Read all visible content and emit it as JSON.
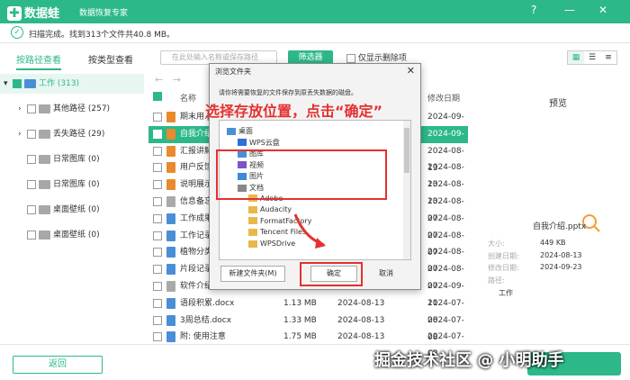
{
  "app": {
    "name": "数据蛙",
    "subtitle": "数据恢复专家",
    "help": "?",
    "minimize": "—",
    "close": "✕"
  },
  "status": {
    "text": "扫描完成。找到313个文件共40.8 MB。"
  },
  "tabs": {
    "by_path": "按路径查看",
    "by_type": "按类型查看"
  },
  "tree": [
    {
      "label": "工作 (313)",
      "expand": "▾"
    },
    {
      "label": "其他路径 (257)",
      "expand": "›"
    },
    {
      "label": "丢失路径 (29)",
      "expand": "›"
    },
    {
      "label": "日常图库 (0)",
      "expand": ""
    },
    {
      "label": "日常图库 (0)",
      "expand": ""
    },
    {
      "label": "桌面壁纸 (0)",
      "expand": ""
    },
    {
      "label": "桌面壁纸 (0)",
      "expand": ""
    }
  ],
  "toolbar": {
    "search_placeholder": "在此处输入名称或保存路径",
    "filter": "筛选器",
    "deleted_only": "仅显示删除项"
  },
  "columns": {
    "name": "名称",
    "modified": "修改日期"
  },
  "files": [
    {
      "name": "期末用.p",
      "size": "",
      "created": "",
      "modified": "2024-09-23",
      "color": "#e88a2d"
    },
    {
      "name": "自我介绍.p",
      "size": "",
      "created": "",
      "modified": "2024-09-23",
      "color": "#e88a2d"
    },
    {
      "name": "汇报讲解.p",
      "size": "",
      "created": "",
      "modified": "2024-08-13",
      "color": "#e88a2d"
    },
    {
      "name": "用户反馈制",
      "size": "",
      "created": "",
      "modified": "2024-08-13",
      "color": "#e88a2d"
    },
    {
      "name": "说明展示.p",
      "size": "",
      "created": "",
      "modified": "2024-08-13",
      "color": "#e88a2d"
    },
    {
      "name": "信息备忘.t",
      "size": "",
      "created": "",
      "modified": "2024-08-07",
      "color": "#aaa"
    },
    {
      "name": "工作成果分",
      "size": "",
      "created": "",
      "modified": "2024-08-07",
      "color": "#4a8fd6"
    },
    {
      "name": "工作记录表",
      "size": "",
      "created": "",
      "modified": "2024-08-07",
      "color": "#4a8fd6"
    },
    {
      "name": "植物分类.d",
      "size": "",
      "created": "",
      "modified": "2024-08-07",
      "color": "#4a8fd6"
    },
    {
      "name": "片段记录.d",
      "size": "",
      "created": "",
      "modified": "2024-08-07",
      "color": "#4a8fd6"
    },
    {
      "name": "软件介绍 -",
      "size": "",
      "created": "",
      "modified": "2024-09-11",
      "color": "#aaa"
    },
    {
      "name": "语段积累.docx",
      "size": "1.13 MB",
      "created": "2024-08-13",
      "modified": "2024-07-08",
      "color": "#4a8fd6"
    },
    {
      "name": "3周总结.docx",
      "size": "1.33 MB",
      "created": "2024-08-13",
      "modified": "2024-07-08",
      "color": "#4a8fd6"
    },
    {
      "name": "附: 使用注意",
      "size": "1.75 MB",
      "created": "2024-08-13",
      "modified": "2024-07-08",
      "color": "#4a8fd6"
    }
  ],
  "preview": {
    "title": "预览",
    "filename": "自我介绍.pptx",
    "size_label": "大小:",
    "size": "449 KB",
    "created_label": "创建日期:",
    "created": "2024-08-13",
    "modified_label": "修改日期:",
    "modified": "2024-09-23",
    "path_label": "路径:",
    "path": "工作"
  },
  "bottom": {
    "back": "返回"
  },
  "dialog": {
    "title": "浏览文件夹",
    "message": "请你将需要恢复的文件保存到原丢失数据的磁盘。",
    "items": [
      {
        "label": "桌面",
        "indent": 0
      },
      {
        "label": "WPS云盘",
        "indent": 1
      },
      {
        "label": "图库",
        "indent": 1
      },
      {
        "label": "视频",
        "indent": 1
      },
      {
        "label": "图片",
        "indent": 1
      },
      {
        "label": "文档",
        "indent": 1
      },
      {
        "label": "Adobe",
        "indent": 2
      },
      {
        "label": "Audacity",
        "indent": 2
      },
      {
        "label": "FormatFactory",
        "indent": 2
      },
      {
        "label": "Tencent Files",
        "indent": 2
      },
      {
        "label": "WPSDrive",
        "indent": 2
      }
    ],
    "new_folder": "新建文件夹(M)",
    "ok": "确定",
    "cancel": "取消"
  },
  "annotation": {
    "text": "选择存放位置，点击“确定”"
  },
  "watermark": "掘金技术社区 @ 小明助手"
}
